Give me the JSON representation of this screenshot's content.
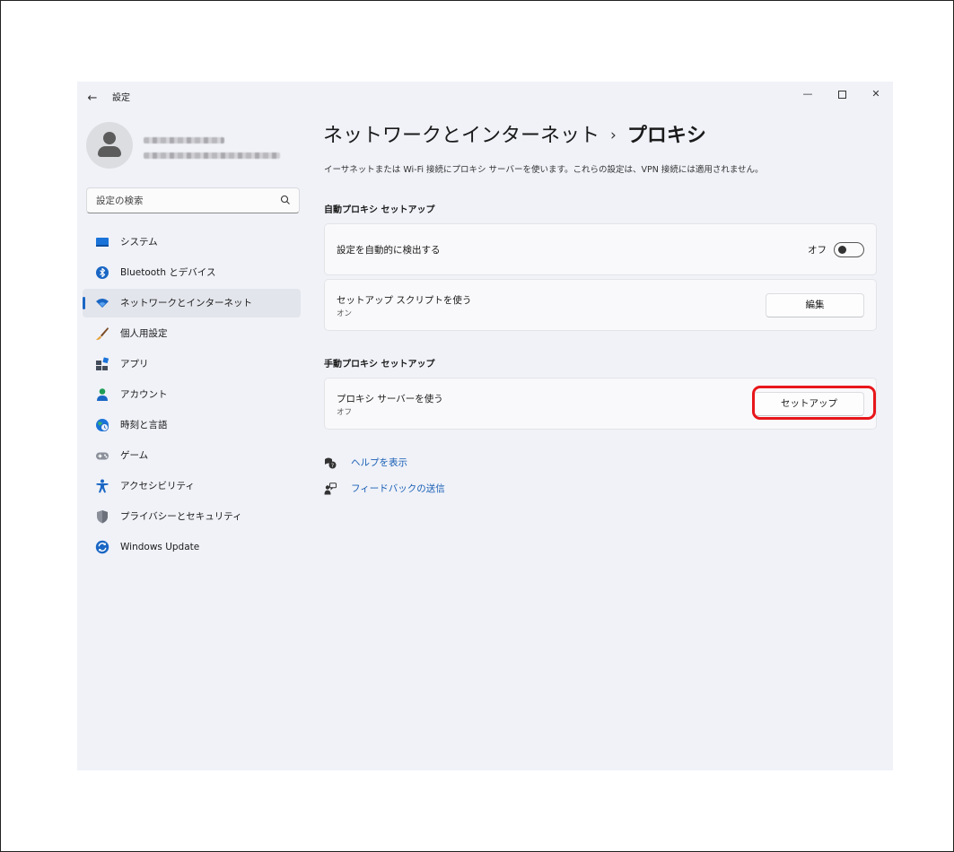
{
  "window": {
    "app_title": "設定",
    "back_label": "←",
    "minimize_label": "—",
    "close_label": "✕"
  },
  "sidebar": {
    "search_placeholder": "設定の検索",
    "items": [
      {
        "label": "システム",
        "icon": "monitor-icon",
        "active": false
      },
      {
        "label": "Bluetooth とデバイス",
        "icon": "bluetooth-icon",
        "active": false
      },
      {
        "label": "ネットワークとインターネット",
        "icon": "wifi-icon",
        "active": true
      },
      {
        "label": "個人用設定",
        "icon": "brush-icon",
        "active": false
      },
      {
        "label": "アプリ",
        "icon": "apps-icon",
        "active": false
      },
      {
        "label": "アカウント",
        "icon": "account-icon",
        "active": false
      },
      {
        "label": "時刻と言語",
        "icon": "globe-clock-icon",
        "active": false
      },
      {
        "label": "ゲーム",
        "icon": "gamepad-icon",
        "active": false
      },
      {
        "label": "アクセシビリティ",
        "icon": "accessibility-icon",
        "active": false
      },
      {
        "label": "プライバシーとセキュリティ",
        "icon": "shield-icon",
        "active": false
      },
      {
        "label": "Windows Update",
        "icon": "update-icon",
        "active": false
      }
    ],
    "accent_color": "#1a66c4"
  },
  "main": {
    "breadcrumb_parent": "ネットワークとインターネット",
    "breadcrumb_separator": "›",
    "breadcrumb_current": "プロキシ",
    "description": "イーサネットまたは Wi-Fi 接続にプロキシ サーバーを使います。これらの設定は、VPN 接続には適用されません。",
    "auto_section": {
      "heading": "自動プロキシ セットアップ",
      "detect_label": "設定を自動的に検出する",
      "detect_state": "オフ",
      "detect_on": false,
      "script_label": "セットアップ スクリプトを使う",
      "script_state": "オン",
      "script_button": "編集"
    },
    "manual_section": {
      "heading": "手動プロキシ セットアップ",
      "proxy_label": "プロキシ サーバーを使う",
      "proxy_state": "オフ",
      "proxy_button": "セットアップ"
    },
    "links": {
      "help": "ヘルプを表示",
      "feedback": "フィードバックの送信"
    },
    "highlight_color": "#e8161b"
  }
}
